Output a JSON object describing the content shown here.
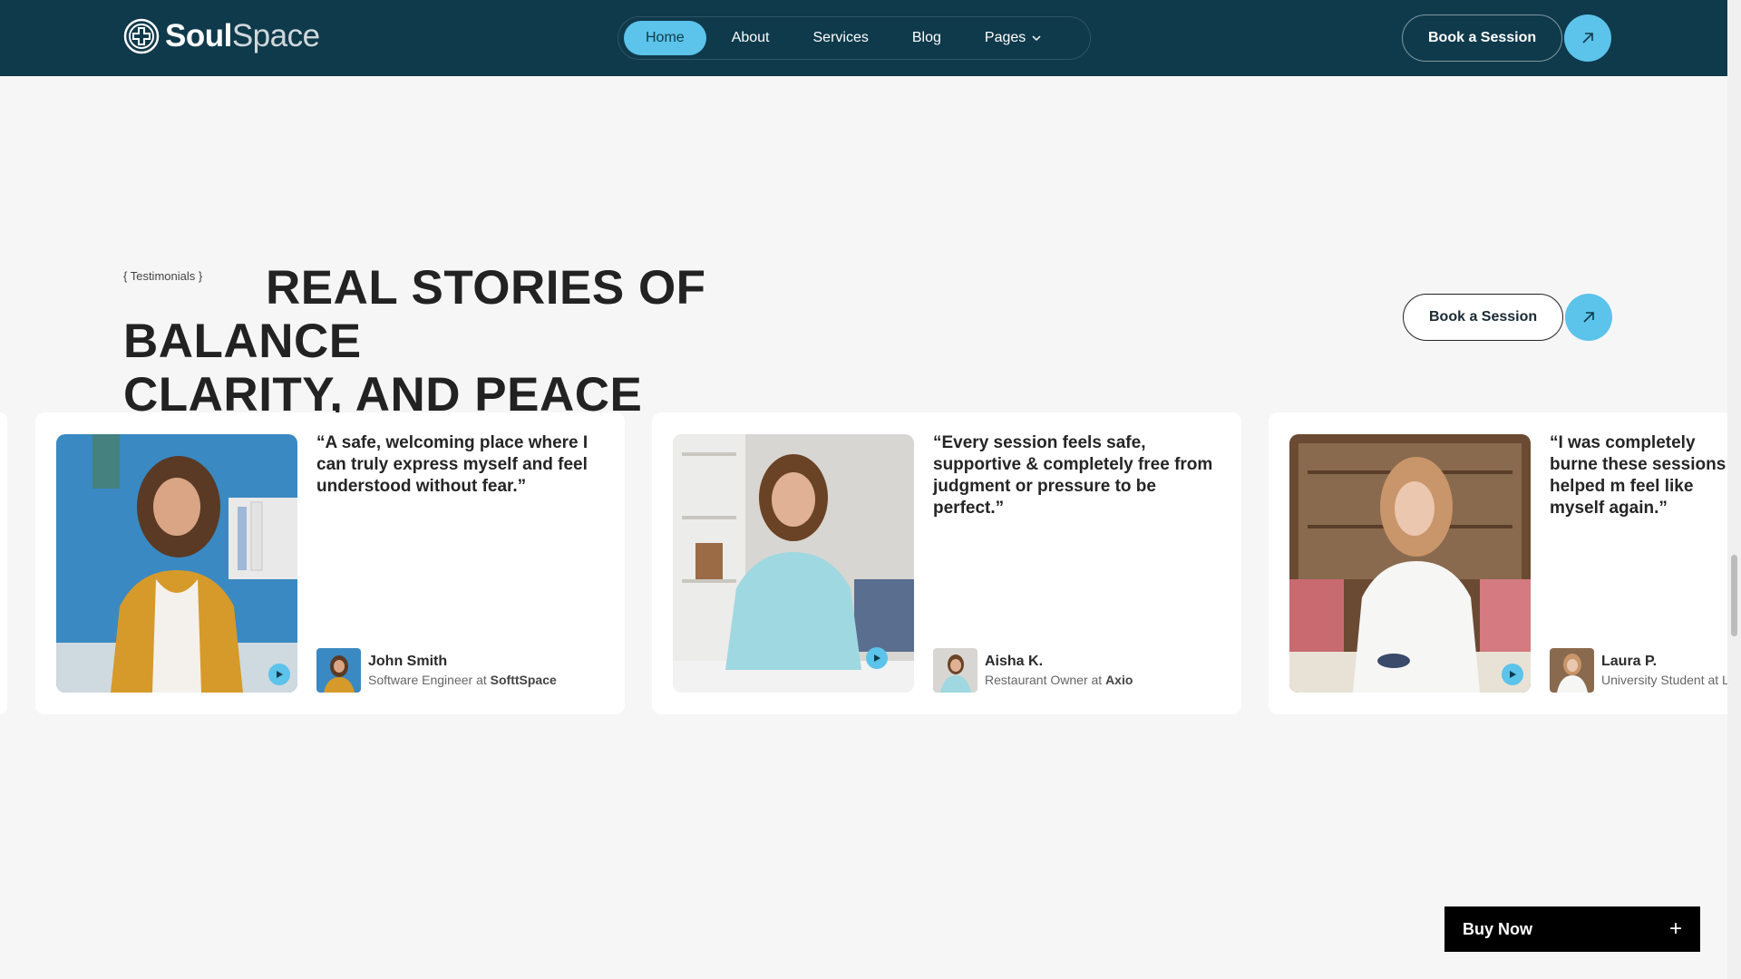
{
  "header": {
    "logo": {
      "bold": "Soul",
      "light": "Space"
    },
    "nav": [
      {
        "label": "Home",
        "active": true
      },
      {
        "label": "About"
      },
      {
        "label": "Services"
      },
      {
        "label": "Blog"
      },
      {
        "label": "Pages",
        "has_dropdown": true
      }
    ],
    "cta_label": "Book a Session"
  },
  "section": {
    "eyebrow": "{ Testimonials }",
    "title_line1": "Real stories of balance",
    "title_line2": "clarity, and peace",
    "cta_label": "Book a Session"
  },
  "testimonials": [
    {
      "quote": "“A safe, welcoming place where I can truly express myself and feel understood without fear.”",
      "name": "John Smith",
      "role": "Software Engineer at",
      "company": "SofttSpace"
    },
    {
      "quote": "“Every session feels safe, supportive & completely free from judgment or pressure to be perfect.”",
      "name": "Aisha K.",
      "role": "Restaurant Owner at",
      "company": "Axio"
    },
    {
      "quote": "“I was completely burne these sessions helped m feel like myself again.”",
      "name": "Laura P.",
      "role": "University  Student at L",
      "company": ""
    }
  ],
  "buy_now": {
    "label": "Buy Now",
    "icon": "plus-icon"
  },
  "colors": {
    "header_bg": "#0f3a4b",
    "accent": "#5cc3ea",
    "page_bg": "#f6f6f6"
  }
}
